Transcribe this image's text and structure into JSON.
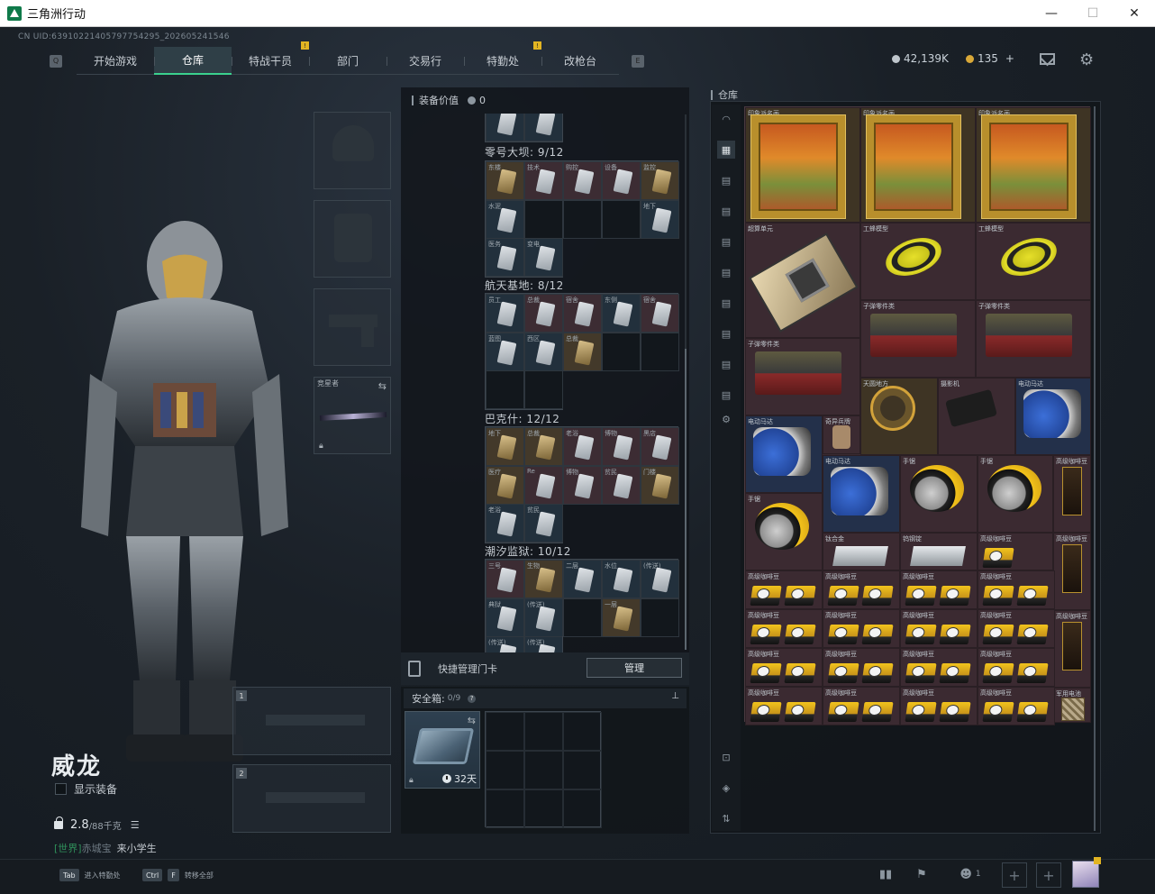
{
  "window": {
    "title": "三角洲行动",
    "minimize": "—",
    "maximize": "☐",
    "close": "✕"
  },
  "uid": "CN UID:6391022140579775429​5_202605241546",
  "nav": {
    "tabs": [
      {
        "label": "开始游戏",
        "active": false,
        "badge": ""
      },
      {
        "label": "仓库",
        "active": true,
        "badge": ""
      },
      {
        "label": "特战干员",
        "active": false,
        "badge": "!"
      },
      {
        "label": "部门",
        "active": false,
        "badge": ""
      },
      {
        "label": "交易行",
        "active": false,
        "badge": ""
      },
      {
        "label": "特勤处",
        "active": false,
        "badge": "!"
      },
      {
        "label": "改枪台",
        "active": false,
        "badge": ""
      }
    ],
    "left_key": "Q",
    "right_key": "E"
  },
  "currency": {
    "hafcoin": "42,139K",
    "tickets": "135",
    "plus": "+"
  },
  "operator": {
    "name": "威龙",
    "show_gear_label": "显示装备",
    "weight": "2.8",
    "weight_max": "/88千克",
    "chat_channel": "[世界]",
    "chat_name": "赤城宝",
    "chat_message": "来小学生"
  },
  "equipment": {
    "backup_weapon_label": "竞星者"
  },
  "weapon_slots": [
    "1",
    "2"
  ],
  "middle_panel": {
    "header": "装备价值",
    "value": "0",
    "sections": [
      {
        "title": "零号大坝: 9/12"
      },
      {
        "title": "航天基地: 8/12"
      },
      {
        "title": "巴克什: 12/12"
      },
      {
        "title": "潮汐监狱: 10/12"
      }
    ],
    "quick_card_label": "快捷管理门卡",
    "manage_button": "管理"
  },
  "safebox": {
    "title": "安全箱:",
    "capacity": "0/9",
    "help": "?",
    "pin": "⊥",
    "days": "32天"
  },
  "warehouse": {
    "title": "仓库",
    "items": [
      {
        "name": "印象派名画"
      },
      {
        "name": "印象派名画"
      },
      {
        "name": "印象派名画"
      },
      {
        "name": "超算单元"
      },
      {
        "name": "工蜂模型"
      },
      {
        "name": "工蜂模型"
      },
      {
        "name": "子弹零件类"
      },
      {
        "name": "子弹零件类"
      },
      {
        "name": "子弹零件类"
      },
      {
        "name": "天圆地方"
      },
      {
        "name": "摄影机"
      },
      {
        "name": "电动马达"
      },
      {
        "name": "电动马达"
      },
      {
        "name": "奇异兵牌"
      },
      {
        "name": "电动马达"
      },
      {
        "name": "手锯"
      },
      {
        "name": "手锯"
      },
      {
        "name": "高级咖啡豆"
      },
      {
        "name": "手锯"
      },
      {
        "name": "钛合金"
      },
      {
        "name": "钨钢锭"
      },
      {
        "name": "高级咖啡豆"
      },
      {
        "name": "高级咖啡豆"
      },
      {
        "name": "高级咖啡豆"
      },
      {
        "name": "军用电池"
      }
    ]
  },
  "bottom": {
    "hint1_key": "Tab",
    "hint1_label": "进入特勤处",
    "hint2_key": "Ctrl",
    "hint2_key2": "F",
    "hint2_label": "转移全部",
    "team_count": "1"
  }
}
